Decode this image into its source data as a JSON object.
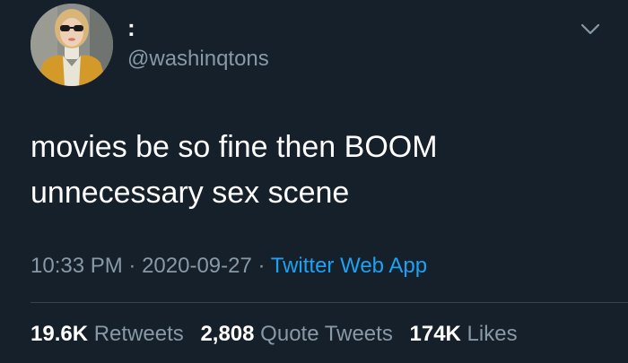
{
  "tweet": {
    "display_name": ":",
    "handle": "@washinqtons",
    "text_line_1": "movies be so fine then BOOM",
    "text_line_2": "unnecessary sex scene",
    "time": "10:33 PM",
    "separator": "·",
    "date": "2020-09-27",
    "source": "Twitter Web App",
    "menu_icon": "chevron-down-icon",
    "avatar_icon": "profile-photo"
  },
  "stats": {
    "retweets_count": "19.6K",
    "retweets_label": "Retweets",
    "quotes_count": "2,808",
    "quotes_label": "Quote Tweets",
    "likes_count": "174K",
    "likes_label": "Likes"
  },
  "colors": {
    "background": "#15202b",
    "text": "#ffffff",
    "secondary": "#8899a6",
    "link": "#1da1f2",
    "divider": "#38444d"
  }
}
